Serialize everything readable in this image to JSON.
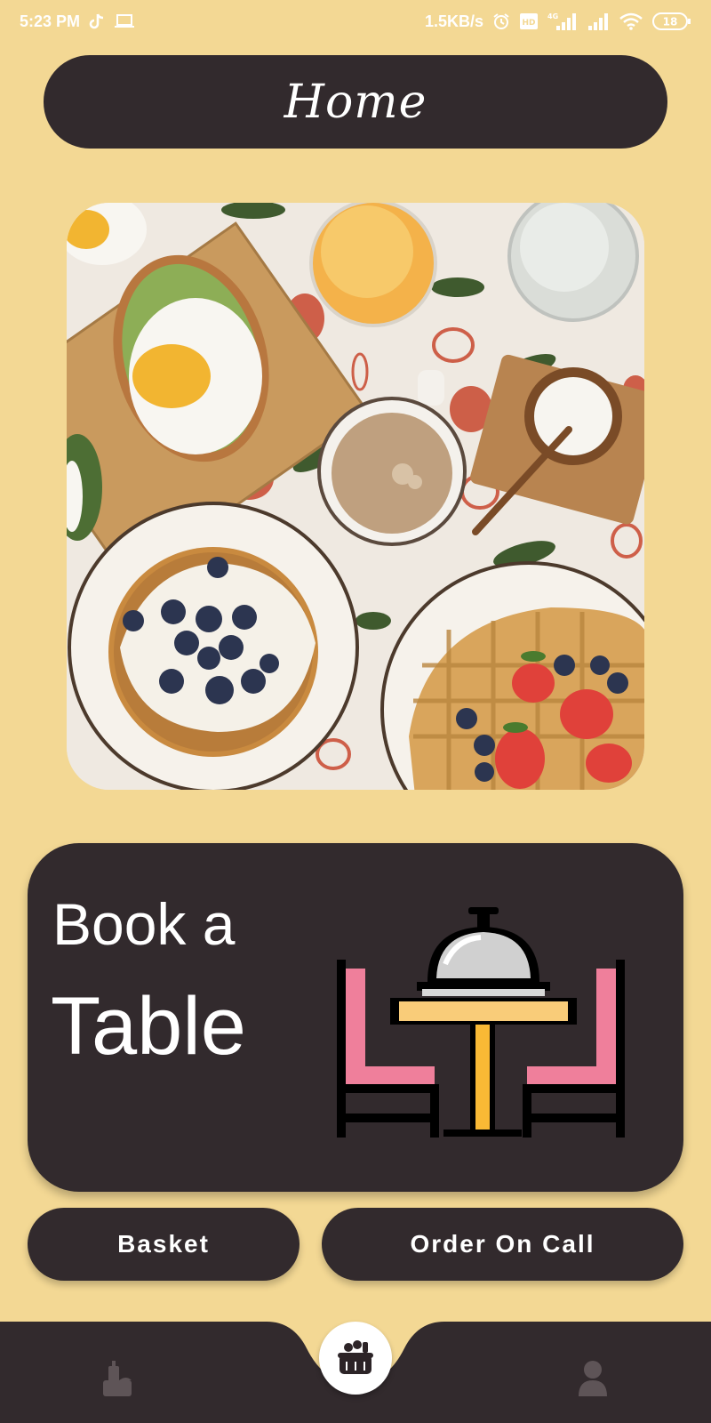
{
  "status_bar": {
    "time": "5:23 PM",
    "network_speed": "1.5KB/s",
    "network_type": "4G",
    "battery_level": "18",
    "icons": [
      "tiktok-icon",
      "laptop-icon",
      "alarm-icon",
      "volte-icon",
      "signal-icon",
      "signal-icon",
      "wifi-icon",
      "battery-icon"
    ]
  },
  "header": {
    "title": "Home"
  },
  "hero": {
    "image_name": "breakfast-table-photo"
  },
  "book_table_card": {
    "line1": "Book a",
    "line2": "Table",
    "illustration": "dining-table-icon"
  },
  "actions": {
    "basket_label": "Basket",
    "order_on_call_label": "Order On Call"
  },
  "bottom_nav": {
    "items": [
      {
        "icon": "restaurant-icon",
        "active": false
      },
      {
        "icon": "basket-icon",
        "active": true
      },
      {
        "icon": "profile-icon",
        "active": false
      }
    ]
  },
  "colors": {
    "background": "#F3D894",
    "dark": "#322A2D",
    "accent_pink": "#EF7F9B",
    "accent_yellow": "#F9C45A"
  }
}
